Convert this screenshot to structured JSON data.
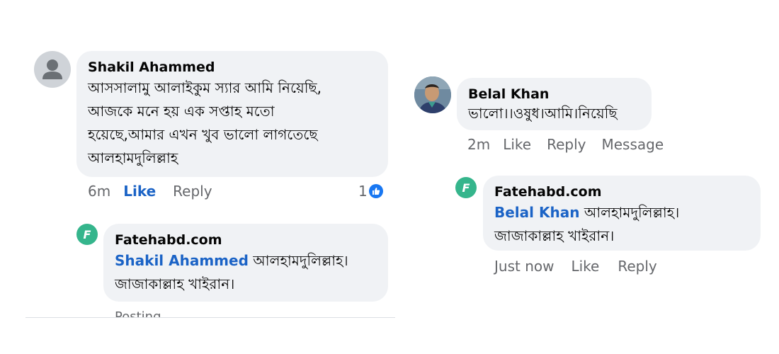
{
  "left_thread": {
    "comment": {
      "author": "Shakil Ahammed",
      "lines": [
        "আসসালামু আলাইকুম স্যার আমি নিয়েছি,",
        "আজকে মনে হয় এক সপ্তাহ  মতো",
        "হয়েছে,আমার এখন খুব ভালো লাগতেছে",
        "আলহামদুলিল্লাহ"
      ],
      "time": "6m",
      "like_label": "Like",
      "reply_label": "Reply",
      "reaction_count": "1"
    },
    "reply": {
      "badge_letter": "F",
      "author": "Fatehabd.com",
      "mention": "Shakil Ahammed",
      "text_line1": "আলহামদুলিল্লাহ।",
      "text_line2": "জাজাকাল্লাহ খাইরান।",
      "status": "Posting"
    }
  },
  "right_thread": {
    "comment": {
      "author": "Belal Khan",
      "text": "ভালো।।ওষুধ।আমি।নিয়েছি",
      "time": "2m",
      "like_label": "Like",
      "reply_label": "Reply",
      "message_label": "Message"
    },
    "reply": {
      "badge_letter": "F",
      "author": "Fatehabd.com",
      "mention": "Belal Khan",
      "text_line1": "আলহামদুলিল্লাহ।",
      "text_line2": "জাজাকাল্লাহ খাইরান।",
      "time": "Just now",
      "like_label": "Like",
      "reply_label": "Reply"
    }
  },
  "colors": {
    "bubble": "#f0f2f5",
    "accent": "#1b63c6",
    "meta": "#65676b",
    "badge": "#35b58c"
  }
}
